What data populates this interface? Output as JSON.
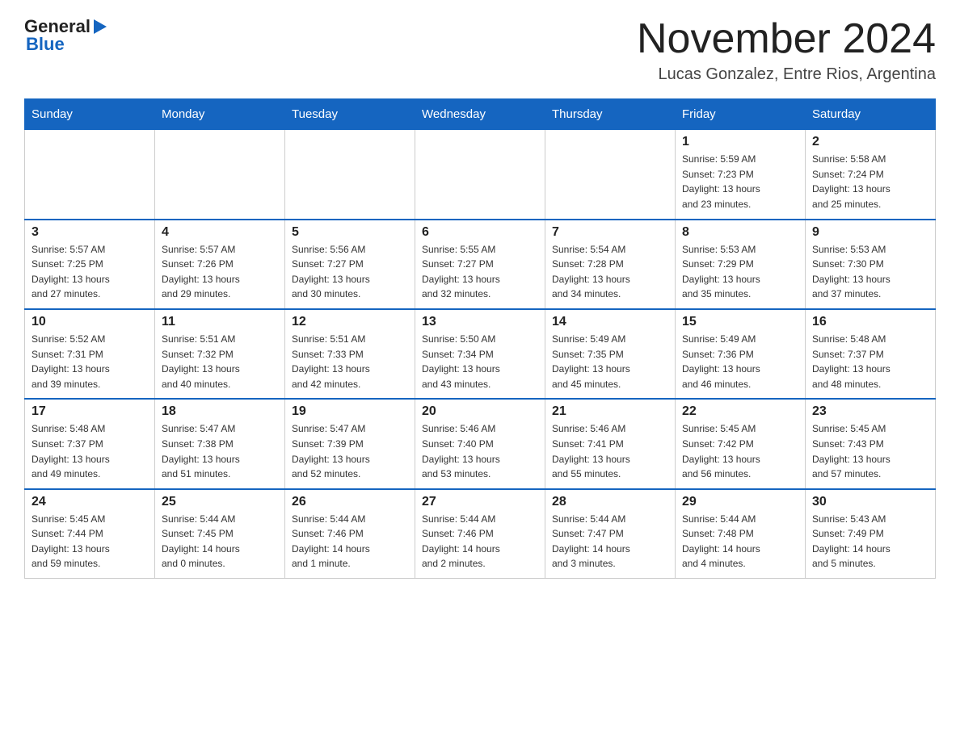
{
  "header": {
    "logo_general": "General",
    "logo_blue": "Blue",
    "month_title": "November 2024",
    "subtitle": "Lucas Gonzalez, Entre Rios, Argentina"
  },
  "days_of_week": [
    "Sunday",
    "Monday",
    "Tuesday",
    "Wednesday",
    "Thursday",
    "Friday",
    "Saturday"
  ],
  "weeks": [
    [
      {
        "day": "",
        "info": ""
      },
      {
        "day": "",
        "info": ""
      },
      {
        "day": "",
        "info": ""
      },
      {
        "day": "",
        "info": ""
      },
      {
        "day": "",
        "info": ""
      },
      {
        "day": "1",
        "info": "Sunrise: 5:59 AM\nSunset: 7:23 PM\nDaylight: 13 hours\nand 23 minutes."
      },
      {
        "day": "2",
        "info": "Sunrise: 5:58 AM\nSunset: 7:24 PM\nDaylight: 13 hours\nand 25 minutes."
      }
    ],
    [
      {
        "day": "3",
        "info": "Sunrise: 5:57 AM\nSunset: 7:25 PM\nDaylight: 13 hours\nand 27 minutes."
      },
      {
        "day": "4",
        "info": "Sunrise: 5:57 AM\nSunset: 7:26 PM\nDaylight: 13 hours\nand 29 minutes."
      },
      {
        "day": "5",
        "info": "Sunrise: 5:56 AM\nSunset: 7:27 PM\nDaylight: 13 hours\nand 30 minutes."
      },
      {
        "day": "6",
        "info": "Sunrise: 5:55 AM\nSunset: 7:27 PM\nDaylight: 13 hours\nand 32 minutes."
      },
      {
        "day": "7",
        "info": "Sunrise: 5:54 AM\nSunset: 7:28 PM\nDaylight: 13 hours\nand 34 minutes."
      },
      {
        "day": "8",
        "info": "Sunrise: 5:53 AM\nSunset: 7:29 PM\nDaylight: 13 hours\nand 35 minutes."
      },
      {
        "day": "9",
        "info": "Sunrise: 5:53 AM\nSunset: 7:30 PM\nDaylight: 13 hours\nand 37 minutes."
      }
    ],
    [
      {
        "day": "10",
        "info": "Sunrise: 5:52 AM\nSunset: 7:31 PM\nDaylight: 13 hours\nand 39 minutes."
      },
      {
        "day": "11",
        "info": "Sunrise: 5:51 AM\nSunset: 7:32 PM\nDaylight: 13 hours\nand 40 minutes."
      },
      {
        "day": "12",
        "info": "Sunrise: 5:51 AM\nSunset: 7:33 PM\nDaylight: 13 hours\nand 42 minutes."
      },
      {
        "day": "13",
        "info": "Sunrise: 5:50 AM\nSunset: 7:34 PM\nDaylight: 13 hours\nand 43 minutes."
      },
      {
        "day": "14",
        "info": "Sunrise: 5:49 AM\nSunset: 7:35 PM\nDaylight: 13 hours\nand 45 minutes."
      },
      {
        "day": "15",
        "info": "Sunrise: 5:49 AM\nSunset: 7:36 PM\nDaylight: 13 hours\nand 46 minutes."
      },
      {
        "day": "16",
        "info": "Sunrise: 5:48 AM\nSunset: 7:37 PM\nDaylight: 13 hours\nand 48 minutes."
      }
    ],
    [
      {
        "day": "17",
        "info": "Sunrise: 5:48 AM\nSunset: 7:37 PM\nDaylight: 13 hours\nand 49 minutes."
      },
      {
        "day": "18",
        "info": "Sunrise: 5:47 AM\nSunset: 7:38 PM\nDaylight: 13 hours\nand 51 minutes."
      },
      {
        "day": "19",
        "info": "Sunrise: 5:47 AM\nSunset: 7:39 PM\nDaylight: 13 hours\nand 52 minutes."
      },
      {
        "day": "20",
        "info": "Sunrise: 5:46 AM\nSunset: 7:40 PM\nDaylight: 13 hours\nand 53 minutes."
      },
      {
        "day": "21",
        "info": "Sunrise: 5:46 AM\nSunset: 7:41 PM\nDaylight: 13 hours\nand 55 minutes."
      },
      {
        "day": "22",
        "info": "Sunrise: 5:45 AM\nSunset: 7:42 PM\nDaylight: 13 hours\nand 56 minutes."
      },
      {
        "day": "23",
        "info": "Sunrise: 5:45 AM\nSunset: 7:43 PM\nDaylight: 13 hours\nand 57 minutes."
      }
    ],
    [
      {
        "day": "24",
        "info": "Sunrise: 5:45 AM\nSunset: 7:44 PM\nDaylight: 13 hours\nand 59 minutes."
      },
      {
        "day": "25",
        "info": "Sunrise: 5:44 AM\nSunset: 7:45 PM\nDaylight: 14 hours\nand 0 minutes."
      },
      {
        "day": "26",
        "info": "Sunrise: 5:44 AM\nSunset: 7:46 PM\nDaylight: 14 hours\nand 1 minute."
      },
      {
        "day": "27",
        "info": "Sunrise: 5:44 AM\nSunset: 7:46 PM\nDaylight: 14 hours\nand 2 minutes."
      },
      {
        "day": "28",
        "info": "Sunrise: 5:44 AM\nSunset: 7:47 PM\nDaylight: 14 hours\nand 3 minutes."
      },
      {
        "day": "29",
        "info": "Sunrise: 5:44 AM\nSunset: 7:48 PM\nDaylight: 14 hours\nand 4 minutes."
      },
      {
        "day": "30",
        "info": "Sunrise: 5:43 AM\nSunset: 7:49 PM\nDaylight: 14 hours\nand 5 minutes."
      }
    ]
  ]
}
